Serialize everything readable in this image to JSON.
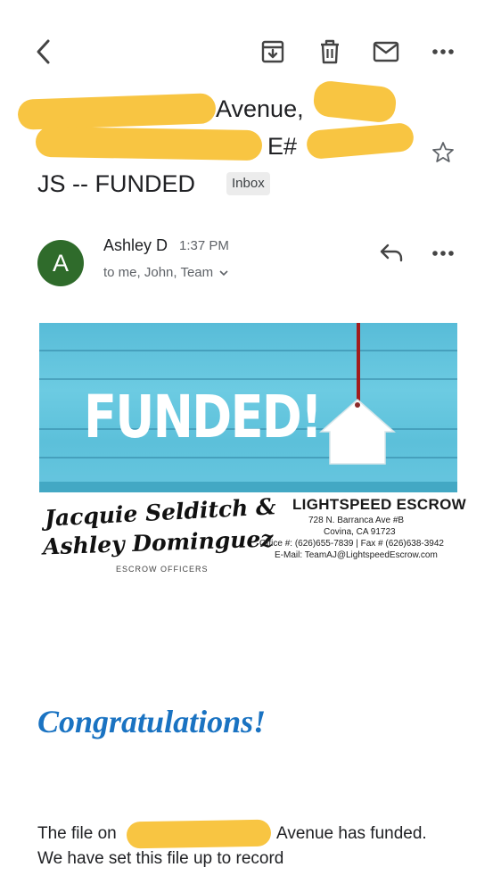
{
  "toolbar": {
    "back_icon": "arrow-left-icon",
    "archive_icon": "archive-icon",
    "delete_icon": "trash-icon",
    "mark_unread_icon": "mail-icon",
    "more_icon": "more-horizontal-icon"
  },
  "subject": {
    "line1_visible": "Avenue,",
    "line2_visible": "E#",
    "line3": "JS  --  FUNDED",
    "label": "Inbox",
    "star_icon": "star-outline-icon"
  },
  "message": {
    "avatar_letter": "A",
    "sender": "Ashley D",
    "time": "1:37 PM",
    "recipients": "to me, John, Team",
    "reply_icon": "reply-icon",
    "more_icon": "more-horizontal-icon"
  },
  "banner": {
    "headline": "FUNDED!",
    "officers_line1": "Jacquie Selditch &",
    "officers_line2": "Ashley Dominguez",
    "officers_caption": "ESCROW OFFICERS",
    "company": "LIGHTSPEED ESCROW",
    "address1": "728 N. Barranca Ave #B",
    "address2": "Covina, CA 91723",
    "phone": "Office #: (626)655-7839 | Fax # (626)638-3942",
    "email": "E-Mail: TeamAJ@LightspeedEscrow.com"
  },
  "body": {
    "greeting": "Congratulations!",
    "line1_start": "The file on",
    "line1_end": "Avenue has funded.",
    "line2": "We have set this file up to record"
  },
  "colors": {
    "redaction": "#f8c542",
    "avatar": "#2f6b2b",
    "congrats": "#1a73c2",
    "banner_blue": "#62c4de"
  }
}
